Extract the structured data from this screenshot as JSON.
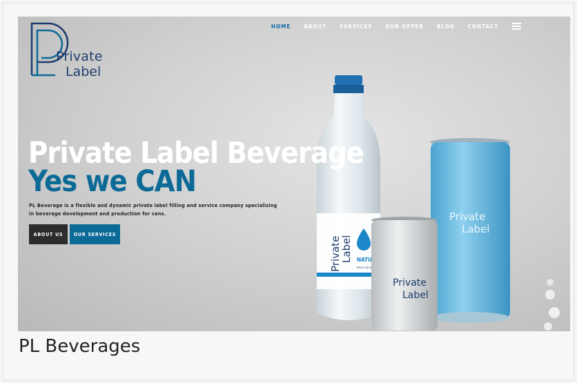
{
  "hero": {
    "logo": {
      "line1": "Private",
      "line2": "Label"
    },
    "nav": {
      "items": [
        {
          "label": "HOME",
          "active": true
        },
        {
          "label": "ABOUT",
          "active": false
        },
        {
          "label": "SERVICES",
          "active": false
        },
        {
          "label": "OUR OFFER",
          "active": false
        },
        {
          "label": "BLOG",
          "active": false
        },
        {
          "label": "CONTACT",
          "active": false
        }
      ],
      "menu_icon": "hamburger-menu-icon"
    },
    "headline_white": "Private Label Beverage",
    "headline_blue": "Yes we CAN",
    "description": "PL Beverage is a flexible and dynamic private label filling and service company specializing in beverage development and production for cans.",
    "buttons": {
      "about": "ABOUT US",
      "services": "OUR SERVICES"
    },
    "products": {
      "bottle_brand_line1": "Private",
      "bottle_brand_line2": "Label",
      "bottle_variant": "NATURELL",
      "bottle_subtext": "REICH AN NATÜRLICHEN MINERALIEN",
      "can_silver_line1": "Private",
      "can_silver_line2": "Label",
      "can_blue_line1": "Private",
      "can_blue_line2": "Label"
    }
  },
  "caption": "PL Beverages",
  "colors": {
    "brand_blue": "#0c6a97",
    "nav_active": "#0b6aa2",
    "dark_button": "#2c2c2c",
    "logo_navy": "#1f3e6d"
  }
}
